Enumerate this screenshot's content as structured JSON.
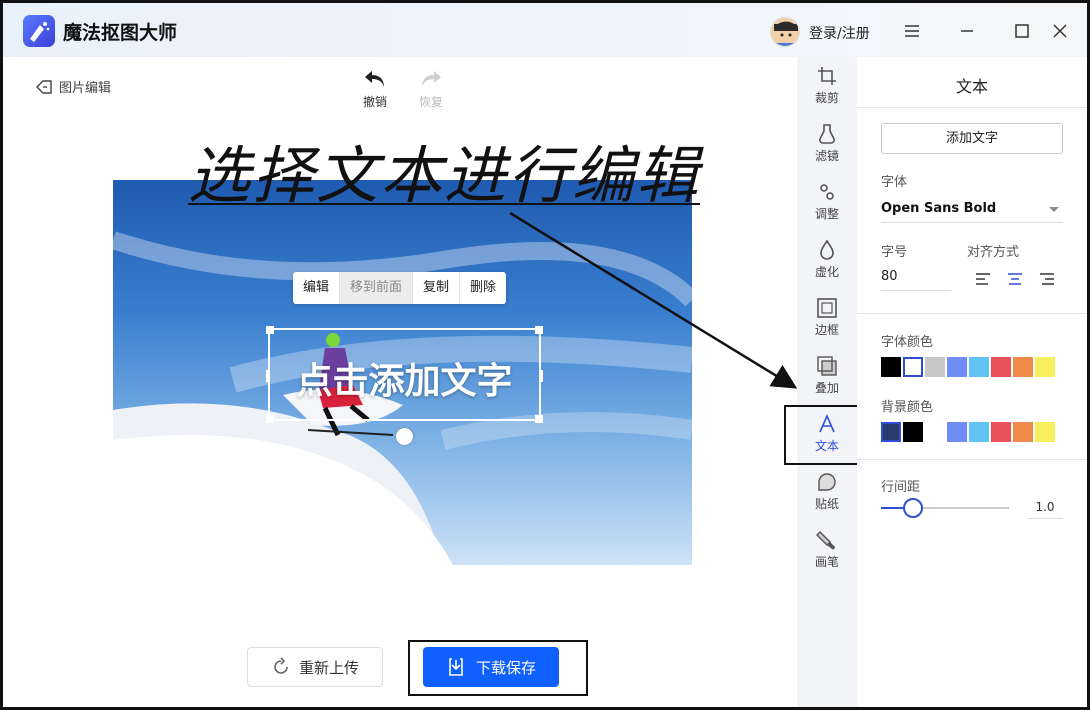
{
  "app": {
    "title": "魔法抠图大师",
    "login": "登录/注册"
  },
  "editor": {
    "back_label": "图片编辑",
    "undo_label": "撤销",
    "redo_label": "恢复",
    "annotation": "选择文本进行编辑",
    "context_menu": [
      "编辑",
      "移到前面",
      "复制",
      "删除"
    ],
    "text_content": "点击添加文字",
    "reupload_label": "重新上传",
    "save_label": "下载保存"
  },
  "tools": [
    {
      "label": "裁剪",
      "icon": "crop-icon"
    },
    {
      "label": "滤镜",
      "icon": "filter-icon"
    },
    {
      "label": "调整",
      "icon": "adjust-icon"
    },
    {
      "label": "虚化",
      "icon": "blur-icon"
    },
    {
      "label": "边框",
      "icon": "border-icon"
    },
    {
      "label": "叠加",
      "icon": "overlay-icon"
    },
    {
      "label": "文本",
      "icon": "text-icon",
      "active": true
    },
    {
      "label": "贴纸",
      "icon": "sticker-icon"
    },
    {
      "label": "画笔",
      "icon": "brush-icon"
    }
  ],
  "panel": {
    "title": "文本",
    "add_text": "添加文字",
    "font_label": "字体",
    "font_value": "Open Sans Bold",
    "size_label": "字号",
    "size_value": "80",
    "align_label": "对齐方式",
    "font_color_label": "字体颜色",
    "font_colors": [
      "#000000",
      "#ffffff",
      "#c8c8c8",
      "#6e8df5",
      "#62c3f5",
      "#e9515b",
      "#ef8a4b",
      "#f7ef5e"
    ],
    "bg_color_label": "背景颜色",
    "bg_colors": [
      "#2a3a6a",
      "#000000",
      "#ffffff",
      "#6e8df5",
      "#62c3f5",
      "#e9515b",
      "#ef8a4b",
      "#f7ef5e"
    ],
    "line_spacing_label": "行间距",
    "line_spacing_value": "1.0",
    "line_spacing_fraction": 0.25
  },
  "colors": {
    "accent": "#2d4fd6",
    "primary_button": "#1060ff"
  }
}
